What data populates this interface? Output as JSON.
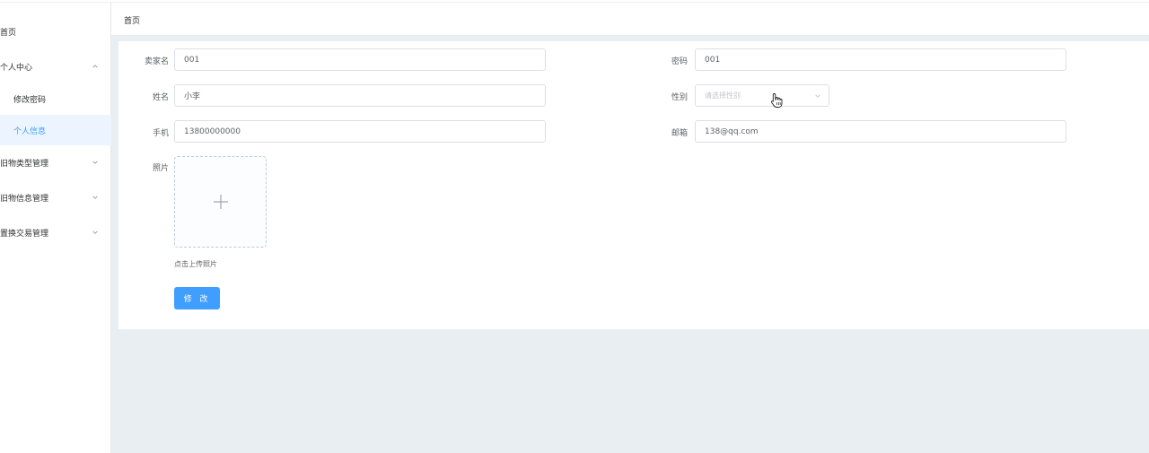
{
  "sidebar": {
    "home": "首页",
    "personal_center": "个人中心",
    "change_password": "修改密码",
    "personal_info": "个人信息",
    "item_type_mgmt": "旧物类型管理",
    "item_info_mgmt": "旧物信息管理",
    "exchange_mgmt": "置换交易管理"
  },
  "header": {
    "breadcrumb": "首页"
  },
  "form": {
    "seller_name": {
      "label": "卖家名",
      "value": "001"
    },
    "password": {
      "label": "密码",
      "value": "001"
    },
    "name": {
      "label": "姓名",
      "value": "小李"
    },
    "gender": {
      "label": "性别",
      "placeholder": "请选择性别"
    },
    "phone": {
      "label": "手机",
      "value": "13800000000"
    },
    "email": {
      "label": "邮箱",
      "value": "138@qq.com"
    },
    "photo": {
      "label": "照片",
      "tip": "点击上传照片"
    },
    "submit_label": "修 改"
  },
  "colors": {
    "primary": "#409eff",
    "active_bg": "#ecf5ff",
    "main_bg": "#e9eef3"
  },
  "icons": {
    "plus": "plus-icon",
    "chevron": "chevron-down-icon",
    "pointer": "hand-pointer-icon"
  }
}
